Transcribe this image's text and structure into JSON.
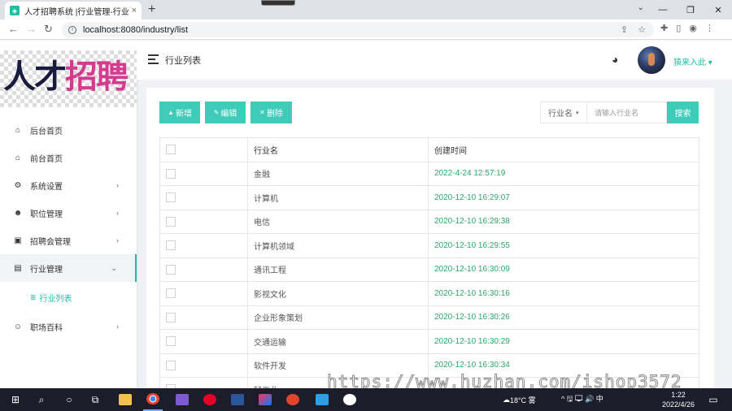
{
  "browser": {
    "tab_title": "人才招聘系统 |行业管理-行业列表",
    "favicon_glyph": "◈",
    "tab_close": "×",
    "new_tab": "+",
    "url": "localhost:8080/industry/list",
    "window_controls": [
      "⌄",
      "—",
      "❐",
      "✕"
    ]
  },
  "sidebar": {
    "logo_text_a": "人才",
    "logo_text_b": "招聘",
    "menu": [
      {
        "label": "后台首页",
        "icon": "home-icon",
        "glyph": "⌂",
        "arrow": ""
      },
      {
        "label": "前台首页",
        "icon": "home-icon",
        "glyph": "⌂",
        "arrow": ""
      },
      {
        "label": "系统设置",
        "icon": "gear-icon",
        "glyph": "⚙",
        "arrow": "›"
      },
      {
        "label": "职位管理",
        "icon": "people-icon",
        "glyph": "☻",
        "arrow": "›"
      },
      {
        "label": "招聘会管理",
        "icon": "briefcase-icon",
        "glyph": "▣",
        "arrow": "›"
      },
      {
        "label": "行业管理",
        "icon": "chat-icon",
        "glyph": "▤",
        "arrow": "⌄"
      },
      {
        "label": "职场百科",
        "icon": "people-outline-icon",
        "glyph": "☺",
        "arrow": "›"
      }
    ],
    "submenu_label": "行业列表",
    "submenu_glyph": "≣"
  },
  "header": {
    "page_heading": "行业列表",
    "palette_glyph": "◕",
    "username": "猿来入此 ▾"
  },
  "toolbar": {
    "add_label": "新增",
    "add_glyph": "▲",
    "edit_label": "编辑",
    "edit_glyph": "✎",
    "delete_label": "删除",
    "delete_glyph": "✕",
    "filter_label": "行业名",
    "filter_caret": "▾",
    "search_placeholder": "请输入行业名",
    "search_label": "搜索"
  },
  "table": {
    "headers": [
      "行业名",
      "创建时间"
    ],
    "rows": [
      [
        "金融",
        "2022-4-24 12:57:19"
      ],
      [
        "计算机",
        "2020-12-10 16:29:07"
      ],
      [
        "电信",
        "2020-12-10 16:29:38"
      ],
      [
        "计算机领域",
        "2020-12-10 16:29:55"
      ],
      [
        "通讯工程",
        "2020-12-10 16:30:09"
      ],
      [
        "影视文化",
        "2020-12-10 16:30:16"
      ],
      [
        "企业形象策划",
        "2020-12-10 16:30:26"
      ],
      [
        "交通运输",
        "2020-12-10 16:30:29"
      ],
      [
        "软件开发",
        "2020-12-10 16:30:34"
      ],
      [
        "轻工业",
        ""
      ]
    ]
  },
  "taskbar": {
    "weather": "18°C 雾",
    "tray": "^ 🖫 🖵 🔊 中",
    "time": "1:22",
    "date": "2022/4/26"
  },
  "watermark": "https://www.huzhan.com/ishop3572"
}
